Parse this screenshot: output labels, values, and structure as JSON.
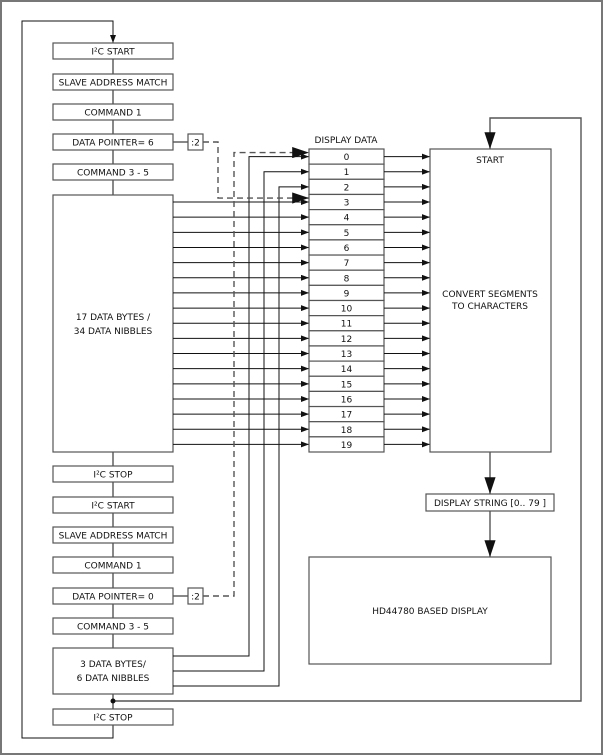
{
  "left_column": {
    "first_sequence": [
      "I²C START",
      "SLAVE ADDRESS MATCH",
      "COMMAND 1",
      "DATA POINTER= 6",
      "COMMAND 3 - 5"
    ],
    "data_block_1": [
      "17 DATA BYTES  /",
      "34 DATA NIBBLES"
    ],
    "stop_1": "I²C STOP",
    "second_sequence": [
      "I²C START",
      "SLAVE ADDRESS MATCH",
      "COMMAND 1",
      "DATA POINTER= 0",
      "COMMAND 3 - 5"
    ],
    "data_block_2": [
      "3 DATA BYTES/",
      "6 DATA NIBBLES"
    ],
    "stop_2": "I²C STOP"
  },
  "divider_label": ":2",
  "display_data": {
    "title": "DISPLAY DATA",
    "rows": [
      "0",
      "1",
      "2",
      "3",
      "4",
      "5",
      "6",
      "7",
      "8",
      "9",
      "10",
      "11",
      "12",
      "13",
      "14",
      "15",
      "16",
      "17",
      "18",
      "19"
    ]
  },
  "convert_box": {
    "start": "START",
    "lines": [
      "CONVERT SEGMENTS",
      "TO CHARACTERS"
    ]
  },
  "display_string": "DISPLAY STRING [0.. 79 ]",
  "hd44780": "HD44780 BASED DISPLAY"
}
